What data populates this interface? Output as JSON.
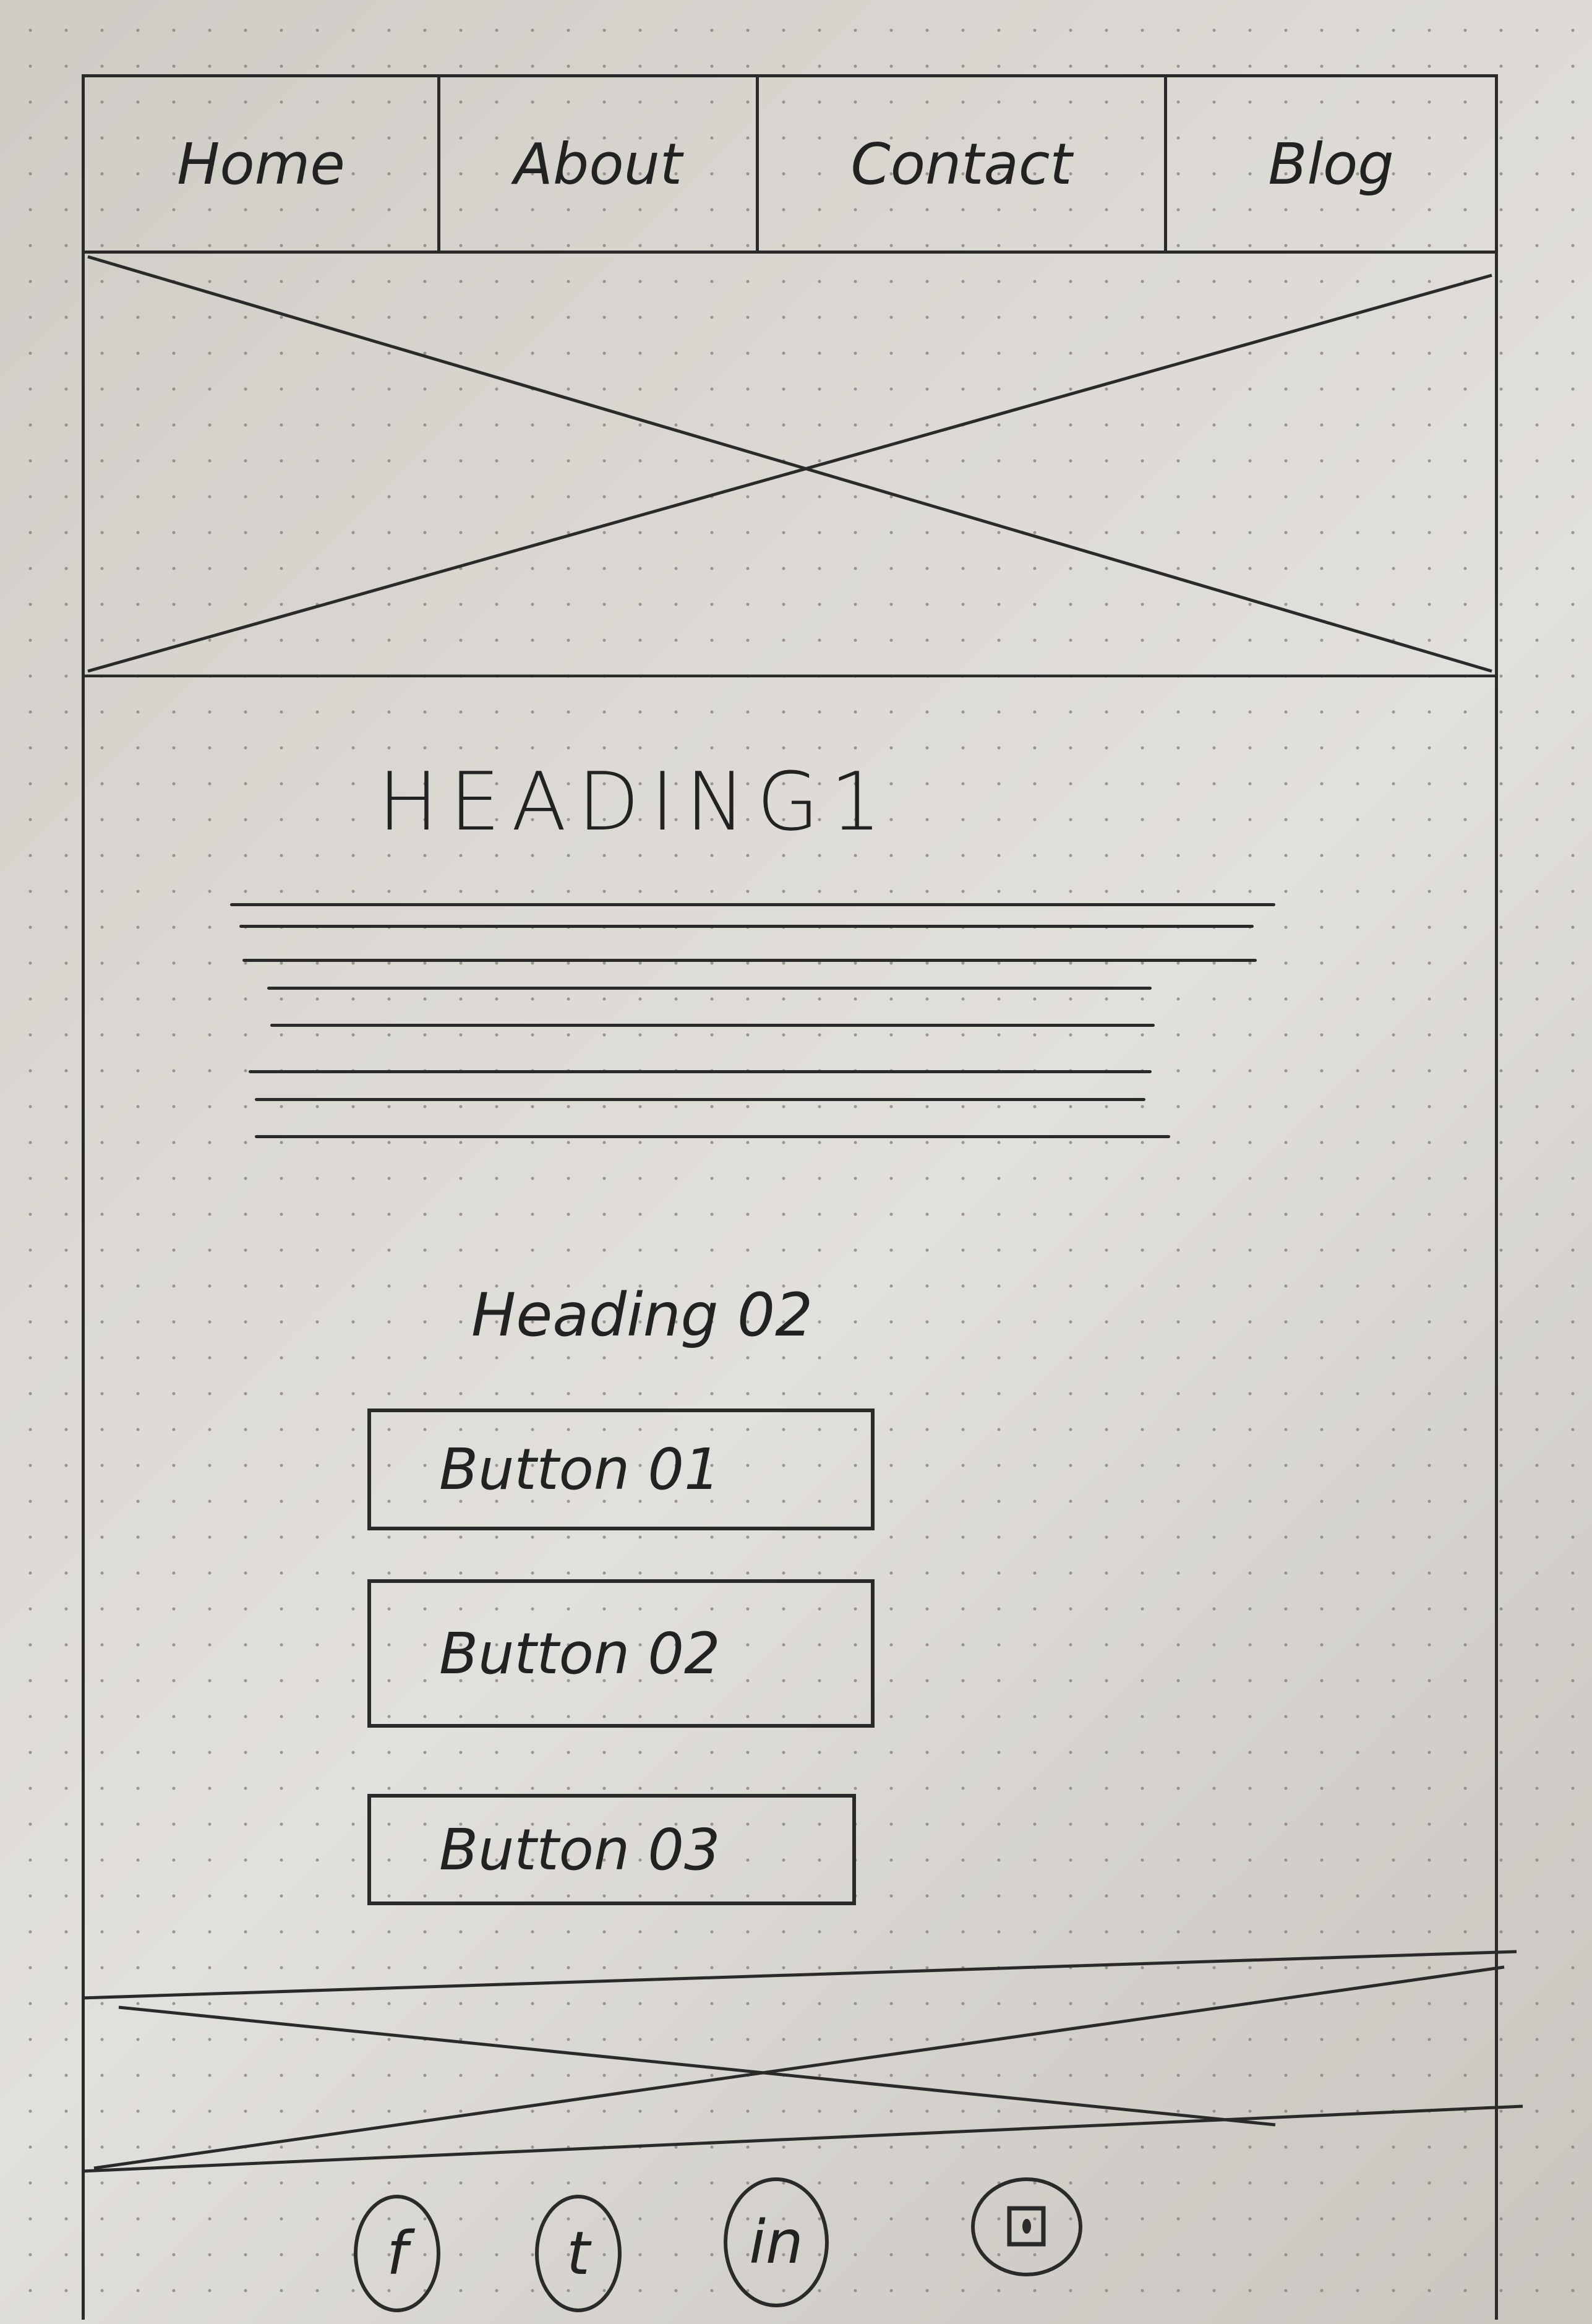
{
  "nav": {
    "items": [
      {
        "label": "Home"
      },
      {
        "label": "About"
      },
      {
        "label": "Contact"
      },
      {
        "label": "Blog"
      }
    ]
  },
  "hero": {
    "type": "image-placeholder"
  },
  "content": {
    "heading1": "HEADING1",
    "paragraph_lines": 8,
    "heading2": "Heading 02",
    "buttons": [
      {
        "label": "Button 01"
      },
      {
        "label": "Button 02"
      },
      {
        "label": "Button 03"
      }
    ]
  },
  "footer_banner": {
    "type": "image-placeholder"
  },
  "social": {
    "icons": [
      {
        "name": "facebook-icon",
        "glyph": "f"
      },
      {
        "name": "twitter-icon",
        "glyph": "t"
      },
      {
        "name": "linkedin-icon",
        "glyph": "in"
      },
      {
        "name": "instagram-icon",
        "glyph": ""
      }
    ]
  },
  "colors": {
    "ink": "#2a2a2a",
    "paper": "#dcd9d4"
  }
}
